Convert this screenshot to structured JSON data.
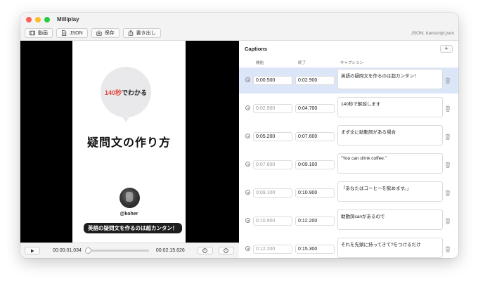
{
  "window": {
    "title": "Milliplay",
    "traffic_lights": {
      "close": "#ff5f57",
      "minimize": "#febc2e",
      "zoom": "#28c840"
    }
  },
  "toolbar": {
    "video_label": "動画",
    "json_label": "JSON",
    "save_label": "保存",
    "export_label": "書き出し",
    "current_file": "JSON: transcript.json"
  },
  "preview": {
    "bubble_highlight": "140秒",
    "bubble_rest": "でわかる",
    "headline": "疑問文の作り方",
    "handle": "@koher",
    "subtitle": "英語の疑問文を作るのは超カンタン！"
  },
  "player": {
    "current_time": "00:00:01.034",
    "total_time": "00:02:15.626",
    "progress": 0.0076
  },
  "captions": {
    "title": "Captions",
    "add_label": "+",
    "columns": {
      "start": "開始",
      "end": "終了",
      "caption": "キャプション"
    },
    "rows": [
      {
        "start": "0:00.500",
        "end": "0:02.900",
        "text": "英語の疑問文を作るのは超カンタン！",
        "selected": true,
        "start_dim": false
      },
      {
        "start": "0:02.900",
        "end": "0:04.700",
        "text": "140秒で解説します",
        "selected": false,
        "start_dim": true
      },
      {
        "start": "0:05.200",
        "end": "0:07.600",
        "text": "まず文に助動詞がある場合",
        "selected": false,
        "start_dim": false
      },
      {
        "start": "0:07.600",
        "end": "0:09.100",
        "text": "\"You can drink coffee.\"",
        "selected": false,
        "start_dim": true
      },
      {
        "start": "0:09.100",
        "end": "0:10.900",
        "text": "「あなたはコーヒーを飲めます。」",
        "selected": false,
        "start_dim": true
      },
      {
        "start": "0:10.900",
        "end": "0:12.200",
        "text": "助動詞canがあるので",
        "selected": false,
        "start_dim": true
      },
      {
        "start": "0:12.200",
        "end": "0:15.300",
        "text": "それを先頭に持ってきて?をつけるだけ",
        "selected": false,
        "start_dim": true
      }
    ]
  }
}
